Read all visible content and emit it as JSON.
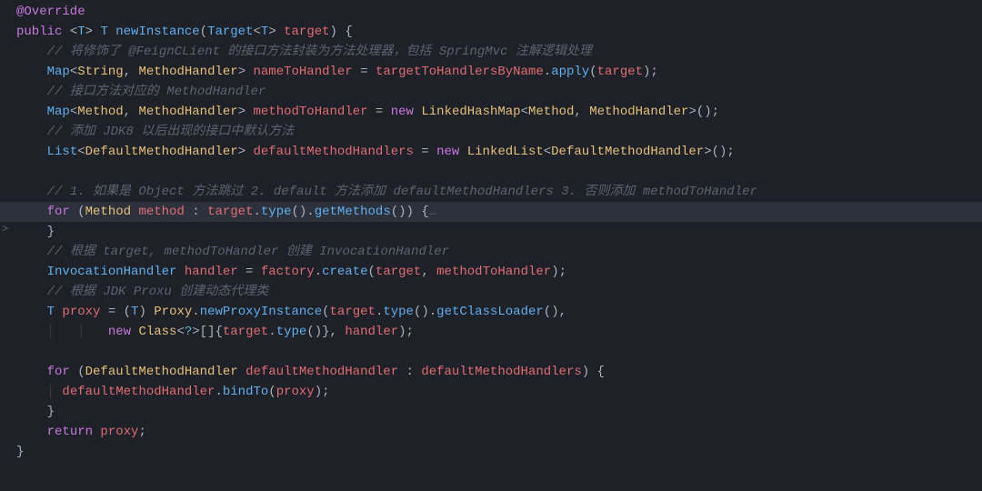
{
  "gutter": {
    "pointer_glyph": ">"
  },
  "code": {
    "l0": {
      "ann": "@Override"
    },
    "l1": {
      "kw_pub": "public ",
      "t_open": "<",
      "t_T": "T",
      "t_close": "> ",
      "t_T2": "T ",
      "fn": "newInstance",
      "paren_o": "(",
      "p_type": "Target",
      "p_gen_o": "<",
      "p_gen_T": "T",
      "p_gen_c": "> ",
      "p_name": "target",
      "paren_c": ") {"
    },
    "l2": {
      "cmt": "// 将修饰了 @FeignCLient 的接口方法封装为方法处理器，包括 SpringMvc 注解逻辑处理"
    },
    "l3": {
      "t_map": "Map",
      "g_o": "<",
      "g1": "String",
      "comma": ", ",
      "g2": "MethodHandler",
      "g_c": "> ",
      "var": "nameToHandler",
      " eq": " = ",
      "obj": "targetToHandlersByName",
      "dot": ".",
      "call": "apply",
      "args": "(",
      "arg1": "target",
      "args_c": ");"
    },
    "l4": {
      "cmt": "// 接口方法对应的 MethodHandler"
    },
    "l5": {
      "t_map": "Map",
      "g_o": "<",
      "g1": "Method",
      "comma": ", ",
      "g2": "MethodHandler",
      "g_c": "> ",
      "var": "methodToHandler",
      " eq": " = ",
      "kw_new": "new ",
      "ctor": "LinkedHashMap",
      "cg_o": "<",
      "cg1": "Method",
      "ccomma": ", ",
      "cg2": "MethodHandler",
      "cg_c": ">();"
    },
    "l6": {
      "cmt": "// 添加 JDK8 以后出现的接口中默认方法"
    },
    "l7": {
      "t_list": "List",
      "g_o": "<",
      "g1": "DefaultMethodHandler",
      "g_c": "> ",
      "var": "defaultMethodHandlers",
      " eq": " = ",
      "kw_new": "new ",
      "ctor": "LinkedList",
      "cg_o": "<",
      "cg1": "DefaultMethodHandler",
      "cg_c": ">();"
    },
    "l8": {
      "blank": " "
    },
    "l9": {
      "cmt": "// 1. 如果是 Object 方法跳过 2. default 方法添加 defaultMethodHandlers 3. 否则添加 methodToHandler"
    },
    "l10": {
      "kw_for": "for ",
      "paren_o": "(",
      "t": "Method ",
      "var": "method ",
      "colon": ": ",
      "obj": "target",
      "dot1": ".",
      "call1": "type",
      "p1": "().",
      "call2": "getMethods",
      "p2": "()) {",
      "fold": "…"
    },
    "l11": {
      "brace": "}"
    },
    "l12": {
      "cmt": "// 根据 target, methodToHandler 创建 InvocationHandler"
    },
    "l13": {
      "t": "InvocationHandler ",
      "var": "handler",
      " eq": " = ",
      "obj": "factory",
      "dot": ".",
      "call": "create",
      "args": "(",
      "a1": "target",
      "c1": ", ",
      "a2": "methodToHandler",
      "args_c": ");"
    },
    "l14": {
      "cmt": "// 根据 JDK Proxu 创建动态代理类"
    },
    "l15": {
      "t_T": "T ",
      "var": "proxy",
      " eq": " = (",
      "t_T2": "T",
      "cast_c": ") ",
      "cls": "Proxy",
      "dot": ".",
      "call": "newProxyInstance",
      "args": "(",
      "a1": "target",
      "d1": ".",
      "c1": "type",
      "p1": "().",
      "c2": "getClassLoader",
      "p2": "(),"
    },
    "l16": {
      "kw_new": "new ",
      "cls": "Class",
      "g_o": "<",
      "q": "?",
      "g_c": ">[]{",
      "a1": "target",
      "d1": ".",
      "c1": "type",
      "p1": "()}, ",
      "a2": "handler",
      "end": ");"
    },
    "l17": {
      "blank": " "
    },
    "l18": {
      "kw_for": "for ",
      "paren_o": "(",
      "t": "DefaultMethodHandler ",
      "var": "defaultMethodHandler ",
      "colon": ": ",
      "it": "defaultMethodHandlers",
      "paren_c": ") {"
    },
    "l19": {
      "obj": "defaultMethodHandler",
      "dot": ".",
      "call": "bindTo",
      "args": "(",
      "a1": "proxy",
      "args_c": ");"
    },
    "l20": {
      "brace": "}"
    },
    "l21": {
      "kw_ret": "return ",
      "var": "proxy",
      "semi": ";"
    },
    "l22": {
      "brace": "}"
    }
  }
}
